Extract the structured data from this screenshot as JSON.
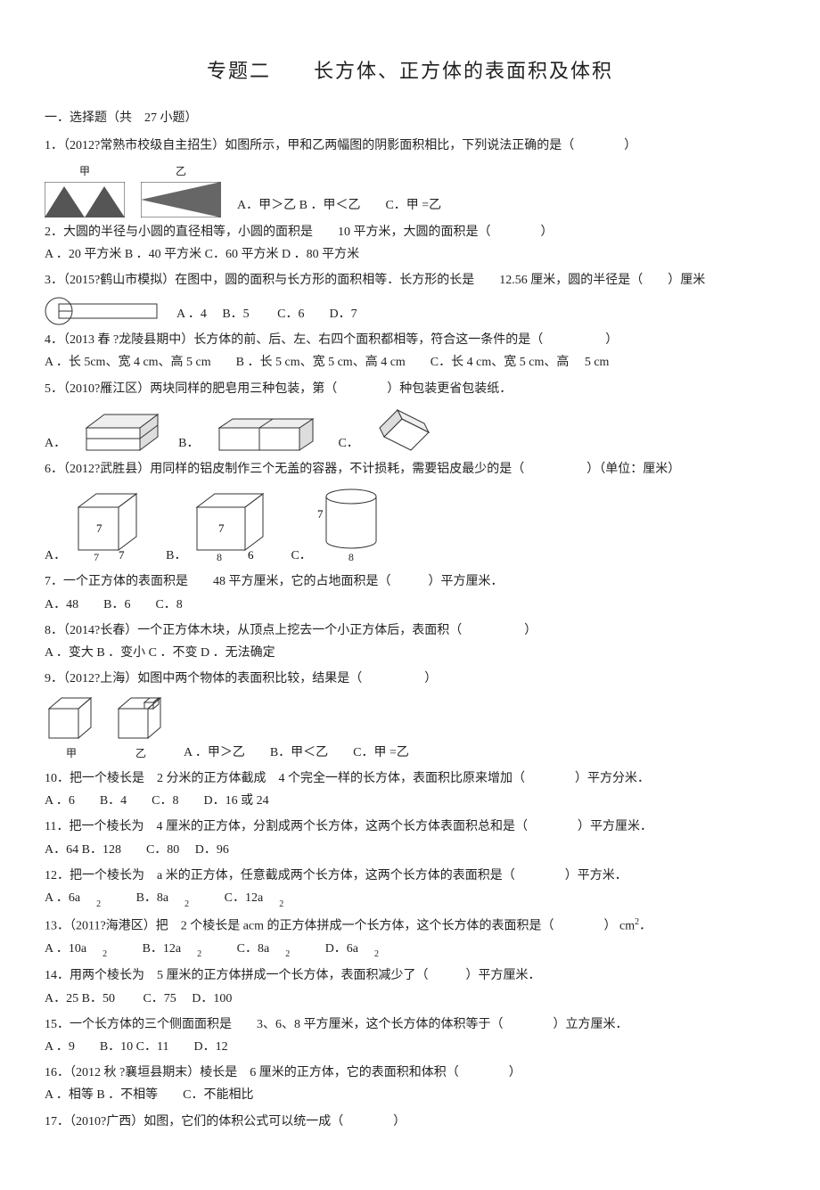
{
  "title": "专题二　　长方体、正方体的表面积及体积",
  "section_head": "一．选择题（共　27 小题）",
  "q1": {
    "text": "1．（2012?常熟市校级自主招生）如图所示，甲和乙两幅图的阴影面积相比，下列说法正确的是（　　　　）",
    "lbl1": "甲",
    "lbl2": "乙",
    "opts": "A．甲＞乙  B ．甲＜乙　　C．甲 =乙"
  },
  "q2": {
    "text": "2．大圆的半径与小圆的直径相等，小圆的面积是　　10 平方米，大圆的面积是（　　　　）",
    "opts": "A ．20 平方米 B ．40 平方米 C．60 平方米 D ．80 平方米"
  },
  "q3": {
    "text": "3．（2015?鹤山市模拟）在图中，圆的面积与长方形的面积相等．长方形的长是　　12.56 厘米，圆的半径是（　　）厘米",
    "opts": "A ．4　 B．5　　 C．6　　D．7"
  },
  "q4": {
    "text": "4．（2013 春 ?龙陵县期中）长方体的前、后、左、右四个面积都相等，符合这一条件的是（　　　　　）",
    "opts": "A ．长 5cm、宽 4 cm、高 5 cm　　B ．长 5 cm、宽 5 cm、高 4 cm　　C．长 4 cm、宽 5 cm、高　 5 cm"
  },
  "q5": {
    "text": "5．（2010?雁江区）两块同样的肥皂用三种包装，第（　　　　）种包装更省包装纸．",
    "A": "A．",
    "B": "B．",
    "C": "C．"
  },
  "q6": {
    "text": "6．（2012?武胜县）用同样的铝皮制作三个无盖的容器，不计损耗，需要铝皮最少的是（　　　　　）（单位：厘米）",
    "A": "A．",
    "B": "B．",
    "C": "C．",
    "n7a": "7",
    "n7b": "7",
    "n7c": "7",
    "n8a": "8",
    "n6a": "6",
    "n7d": "7",
    "n8b": "8"
  },
  "q7": {
    "text": "7．一个正方体的表面积是　　48 平方厘米，它的占地面积是（　　　）平方厘米．",
    "opts": "A．48　　B．6　　C．8"
  },
  "q8": {
    "text": "8．（2014?长春）一个正方体木块，从顶点上挖去一个小正方体后，表面积（　　　　　）",
    "opts": "A ．变大  B ．变小 C ．不变  D ．无法确定"
  },
  "q9": {
    "text": "9．（2012?上海）如图中两个物体的表面积比较，结果是（　　　　　）",
    "lbl1": "甲",
    "lbl2": "乙",
    "opts": "A ．甲＞乙　　B．甲＜乙　　C．甲 =乙"
  },
  "q10": {
    "text": "10．把一个棱长是　2 分米的正方体截成　4 个完全一样的长方体，表面积比原来增加（　　　　）平方分米．",
    "opts": "A ．6　　B．4　　C．8　　D．16 或 24"
  },
  "q11": {
    "text": "11．把一个棱长为　4 厘米的正方体，分割成两个长方体，这两个长方体表面积总和是（　　　　）平方厘米．",
    "opts": "A．64  B．128　　C．80　 D．96"
  },
  "q12": {
    "text": "12．把一个棱长为　a 米的正方体，任意截成两个长方体，这两个长方体的表面积是（　　　　）平方米．",
    "opts_a": "A ．6a",
    "opts_b": "B．8a",
    "opts_c": "C．12a",
    "sub": "2"
  },
  "q13": {
    "text": "13．（2011?海港区）把　2 个棱长是 acm 的正方体拼成一个长方体，这个长方体的表面积是（　　　　） cm",
    "sup2": "2",
    "opts_a": "A ．10a",
    "opts_b": "B．12a",
    "opts_c": "C．8a",
    "opts_d": "D．6a",
    "sub": "2"
  },
  "q14": {
    "text": "14．用两个棱长为　5 厘米的正方体拼成一个长方体，表面积减少了（　　　）平方厘米．",
    "opts": "A．25  B．50　　 C．75　 D．100"
  },
  "q15": {
    "text": "15．一个长方体的三个侧面面积是　　3、6、8 平方厘米，这个长方体的体积等于（　　　　）立方厘米．",
    "opts": "A ．9　　B．10  C．11　　D．12"
  },
  "q16": {
    "text": "16．（2012 秋 ?襄垣县期末）棱长是　6 厘米的正方体，它的表面积和体积（　　　　）",
    "opts": "A ．相等  B ．不相等　　C．不能相比"
  },
  "q17": {
    "text": "17．（2010?广西）如图，它们的体积公式可以统一成（　　　　）"
  }
}
